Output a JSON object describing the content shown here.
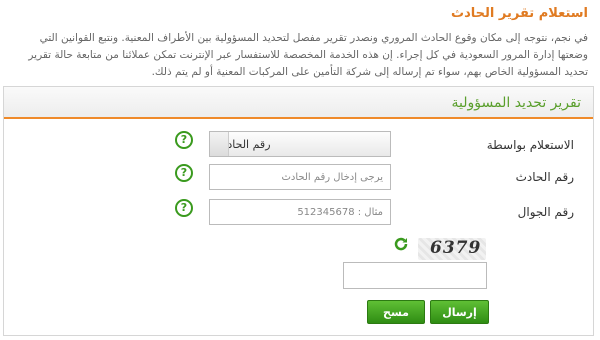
{
  "page": {
    "title": "استعلام تقرير الحادث",
    "intro": "في نجم، نتوجه إلى مكان وقوع الحادث المروري ونصدر تقرير مفصل لتحديد المسؤولية بين الأطراف المعنية. ونتبع القوانين التي وضعتها إدارة المرور السعودية في كل إجراء. إن هذه الخدمة المخصصة للاستفسار عبر الإنترنت تمكن عملائنا من متابعة حالة تقرير تحديد المسؤولية الخاص بهم، سواء تم إرساله إلى شركة التأمين على المركبات المعنية أو لم يتم ذلك."
  },
  "form": {
    "title": "تقرير تحديد المسؤولية",
    "inquiry_by": {
      "label": "الاستعلام بواسطة",
      "selected": "رقم الحادث"
    },
    "accident_number": {
      "label": "رقم الحادث",
      "placeholder": "يرجى إدخال رقم الحادث"
    },
    "mobile": {
      "label": "رقم الجوال",
      "placeholder": "مثال : 512345678"
    },
    "captcha": {
      "code": "6379",
      "value": ""
    },
    "help_glyph": "?",
    "buttons": {
      "submit": "إرسال",
      "clear": "مسح"
    }
  },
  "colors": {
    "accent_orange": "#e07b22",
    "accent_green": "#5a9f2c",
    "button_green": "#3f9e1d"
  },
  "icons": {
    "help": "help-question-icon",
    "refresh": "refresh-captcha-icon"
  }
}
